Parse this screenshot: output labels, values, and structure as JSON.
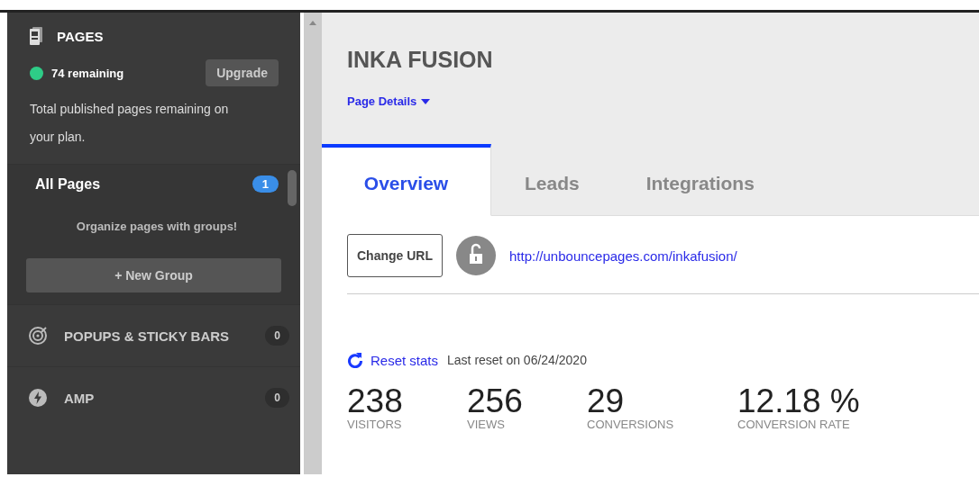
{
  "sidebar": {
    "header": {
      "title": "PAGES",
      "remaining": "74 remaining",
      "upgrade": "Upgrade",
      "note": "Total published pages remaining on your plan."
    },
    "all_pages": {
      "label": "All Pages",
      "count": "1",
      "hint": "Organize pages with groups!"
    },
    "new_group": "+ New Group",
    "items": [
      {
        "kind": "popup",
        "label": "POPUPS & STICKY BARS",
        "count": "0"
      },
      {
        "kind": "amp",
        "label": "AMP",
        "count": "0"
      }
    ]
  },
  "main": {
    "title": "INKA FUSION",
    "details": "Page Details",
    "tabs": [
      {
        "label": "Overview",
        "selected": true
      },
      {
        "label": "Leads",
        "selected": false
      },
      {
        "label": "Integrations",
        "selected": false
      }
    ],
    "change_url": "Change URL",
    "locked": false,
    "url": "http://unbouncepages.com/inkafusion/",
    "reset": "Reset stats",
    "last_reset": "Last reset on 06/24/2020",
    "stats": [
      {
        "value": "238",
        "label": "VISITORS"
      },
      {
        "value": "256",
        "label": "VIEWS"
      },
      {
        "value": "29",
        "label": "CONVERSIONS"
      },
      {
        "value": "12.18 %",
        "label": "CONVERSION RATE"
      }
    ]
  }
}
